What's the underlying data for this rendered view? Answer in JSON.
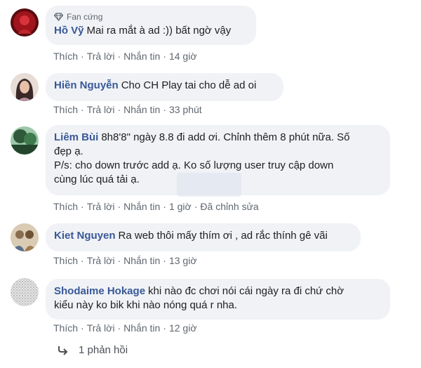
{
  "comments": [
    {
      "author": "Hồ Vỹ",
      "badge": "Fan cứng",
      "text": "Mai ra mắt à ad :)) bất ngờ vậy",
      "actions": {
        "like": "Thích",
        "reply": "Trả lời",
        "message": "Nhắn tin",
        "time": "14 giờ",
        "edited": ""
      },
      "avatar_color": "#a0141c"
    },
    {
      "author": "Hiền Nguyễn",
      "text": "Cho CH Play tai cho dễ ad oi",
      "actions": {
        "like": "Thích",
        "reply": "Trả lời",
        "message": "Nhắn tin",
        "time": "33 phút",
        "edited": ""
      },
      "avatar_color": "#6b4a4a"
    },
    {
      "author": "Liêm Bùi",
      "text_line1": "8h8'8\" ngày 8.8 đi add ơi. Chỉnh thêm 8 phút nữa. Số",
      "text_line2": "đẹp ạ.",
      "text_line3": "P/s: cho down trước add ạ. Ko số lượng user truy cập down",
      "text_line4": "cùng lúc quá tải ạ.",
      "actions": {
        "like": "Thích",
        "reply": "Trả lời",
        "message": "Nhắn tin",
        "time": "1 giờ",
        "edited": "Đã chỉnh sửa"
      },
      "avatar_color": "#2f5a3a"
    },
    {
      "author": "Kiet Nguyen",
      "text": "Ra web thôi mấy thím ơi , ad rắc thính gê vãi",
      "actions": {
        "like": "Thích",
        "reply": "Trả lời",
        "message": "Nhắn tin",
        "time": "13 giờ",
        "edited": ""
      },
      "avatar_color": "#8a6d4f"
    },
    {
      "author": "Shodaime Hokage",
      "text_line1": "khi nào đc chơi nói cái ngày ra đi chứ chờ",
      "text_line2": "kiểu này ko bik khi nào nóng quá r nha.",
      "actions": {
        "like": "Thích",
        "reply": "Trả lời",
        "message": "Nhắn tin",
        "time": "12 giờ",
        "edited": ""
      },
      "avatar_color": "#c8c8c8"
    }
  ],
  "replies_link": "1 phản hồi",
  "colors": {
    "link": "#385898",
    "bubble": "#f0f2f5",
    "meta": "#606770"
  }
}
